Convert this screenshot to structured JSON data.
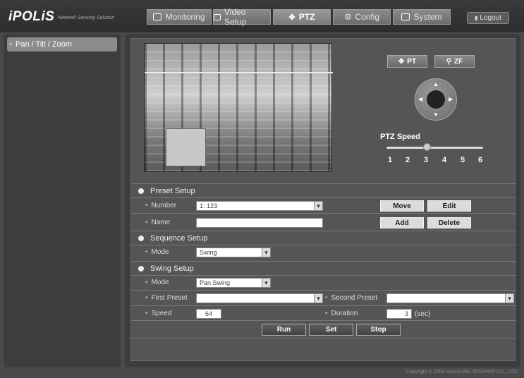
{
  "header": {
    "logo": "iPOLiS",
    "tagline": "Network Security Solution",
    "nav": [
      {
        "label": "Monitoring",
        "icon": "monitor-icon"
      },
      {
        "label": "Video Setup",
        "icon": "video-setup-icon"
      },
      {
        "label": "PTZ",
        "icon": "ptz-icon"
      },
      {
        "label": "Config",
        "icon": "gear-icon"
      },
      {
        "label": "System",
        "icon": "system-icon"
      }
    ],
    "logout": "Logout"
  },
  "sidebar": {
    "items": [
      {
        "label": "Pan / Tilt / Zoom"
      }
    ]
  },
  "ptz": {
    "pt_button": "PT",
    "zf_button": "ZF",
    "speed_label": "PTZ Speed",
    "speed_ticks": [
      "1",
      "2",
      "3",
      "4",
      "5",
      "6"
    ],
    "speed_value": 3
  },
  "preset": {
    "title": "Preset Setup",
    "number_label": "Number",
    "number_value": "1: 123",
    "name_label": "Name",
    "name_value": "",
    "move": "Move",
    "edit": "Edit",
    "add": "Add",
    "delete": "Delete"
  },
  "sequence": {
    "title": "Sequence Setup",
    "mode_label": "Mode",
    "mode_value": "Swing"
  },
  "swing": {
    "title": "Swing Setup",
    "mode_label": "Mode",
    "mode_value": "Pan Swing",
    "first_label": "First Preset",
    "first_value": "",
    "second_label": "Second Preset",
    "second_value": "",
    "speed_label": "Speed",
    "speed_value": "64",
    "duration_label": "Duration",
    "duration_value": "3",
    "duration_unit": "(sec)",
    "run": "Run",
    "set": "Set",
    "stop": "Stop"
  },
  "footer": {
    "copyright": "Copyright © 2009 SAMSUNG TECHWIN CO., LTD."
  }
}
